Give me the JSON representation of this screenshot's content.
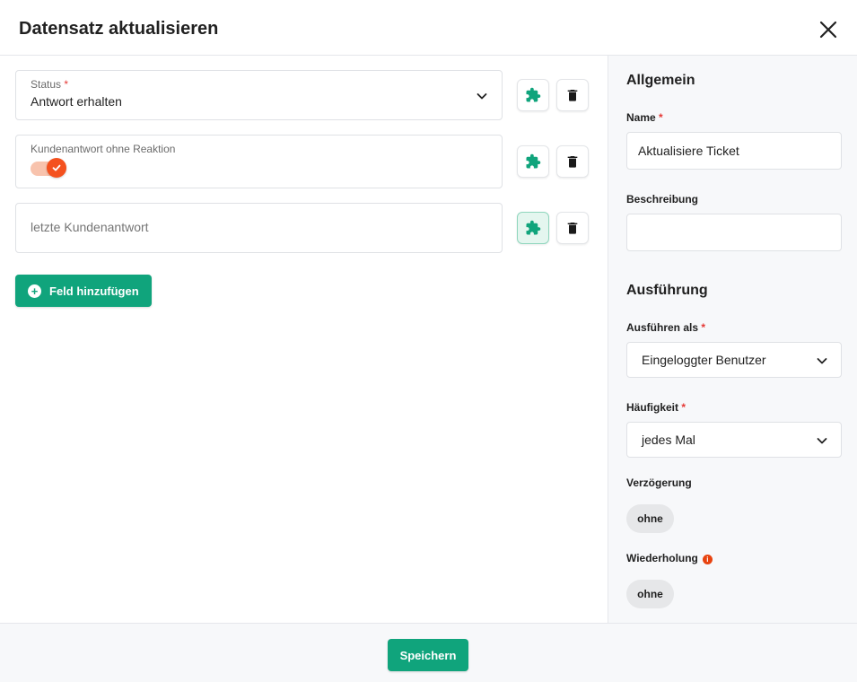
{
  "dialog": {
    "title": "Datensatz aktualisieren",
    "close_icon": "close-icon"
  },
  "fields": [
    {
      "label": "Status",
      "required_mark": "*",
      "value": "Antwort erhalten",
      "type": "select"
    },
    {
      "label": "Kundenantwort ohne Reaktion",
      "type": "toggle",
      "checked": true
    },
    {
      "placeholder": "letzte Kundenantwort",
      "type": "text"
    }
  ],
  "field_actions": {
    "variable_icon": "puzzle-icon",
    "delete_icon": "trash-icon"
  },
  "add_field_label": "Feld hinzufügen",
  "sidebar": {
    "general_title": "Allgemein",
    "name_label": "Name",
    "name_required": "*",
    "name_value": "Aktualisiere Ticket",
    "description_label": "Beschreibung",
    "description_value": "",
    "execution_title": "Ausführung",
    "run_as_label": "Ausführen als",
    "run_as_required": "*",
    "run_as_value": "Eingeloggter Benutzer",
    "frequency_label": "Häufigkeit",
    "frequency_required": "*",
    "frequency_value": "jedes Mal",
    "delay_label": "Verzögerung",
    "delay_value": "ohne",
    "repeat_label": "Wiederholung",
    "repeat_value": "ohne",
    "info_icon_glyph": "i"
  },
  "footer": {
    "save_label": "Speichern"
  },
  "colors": {
    "accent": "#10a47c",
    "toggle_on": "#f4511e",
    "required": "#e53935"
  }
}
